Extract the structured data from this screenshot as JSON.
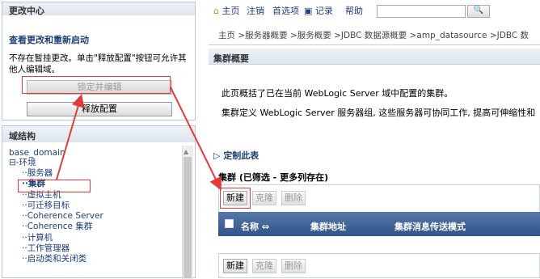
{
  "change_center": {
    "title": "更改中心",
    "view_link": "查看更改和重新启动",
    "description": "不存在暂挂更改。单击\"释放配置\"按钮可允许其他人编辑域。",
    "lock_button": "锁定并编辑",
    "release_button": "释放配置"
  },
  "domain_structure": {
    "title": "域结构",
    "root": "base_domain",
    "items": [
      "环境",
      "服务器",
      "集群",
      "虚拟主机",
      "可迁移目标",
      "Coherence Server",
      "Coherence 集群",
      "计算机",
      "工作管理器",
      "启动类和关闭类"
    ]
  },
  "topnav": {
    "home": "主页",
    "logout": "注销",
    "preferences": "首选项",
    "record": "记录",
    "help": "帮助"
  },
  "breadcrumb": "主页 >服务器概要 >服务概要 >JDBC 数据源概要 >amp_datasource >JDBC 数",
  "summary": {
    "title": "集群概要",
    "desc1": "此页概括了已在当前 WebLogic Server 域中配置的集群。",
    "desc2": "集群定义 WebLogic Server 服务器组, 这些服务器可协同工作, 提高可伸缩性和"
  },
  "customize_link": "定制此表",
  "cluster_table": {
    "title": "集群 (已筛选 - 更多列存在)",
    "buttons": {
      "new": "新建",
      "clone": "克隆",
      "delete": "删除"
    },
    "columns": [
      "名称 ⇔",
      "集群地址",
      "集群消息传送模式"
    ]
  },
  "colors": {
    "accent": "#e23b3b",
    "header_blue": "#2f5488"
  }
}
